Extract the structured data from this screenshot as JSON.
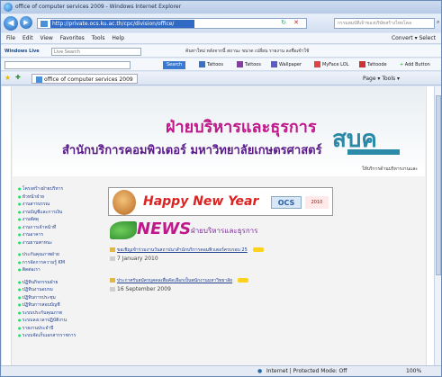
{
  "window": {
    "title": "office of computer services 2009 - Windows Internet Explorer"
  },
  "address": {
    "url": "http://private.ocs.ku.ac.th/cpc/division/office/",
    "search_placeholder": "กรรมสมบัติเจ้าของบริษัทสร้างไทยโคล"
  },
  "menu": {
    "items": [
      "File",
      "Edit",
      "View",
      "Favorites",
      "Tools",
      "Help"
    ],
    "right": "Convert ▾  Select"
  },
  "toolbar1": {
    "live": "Windows Live",
    "search_placeholder": "Live Search",
    "right": "ค้นหาใหม่  หลังจากนี้  สถานะ  ขนาด  เปลี่ยน  รายงาน    ลงชื่อเข้าใช้"
  },
  "toolbar2": {
    "search_btn": "Search",
    "links": [
      "Tattoos",
      "Tattoos",
      "Wallpaper",
      "MyFace LOL",
      "Tattoode",
      "Add Button"
    ]
  },
  "favbar": {
    "tab": "office of computer services 2009",
    "right": "Page ▾  Tools ▾"
  },
  "header": {
    "thai_title": "ฝ่ายบริหารและธุรการ",
    "thai_subtitle": "สำนักบริการคอมพิวเตอร์ มหาวิทยาลัยเกษตรศาสตร์",
    "logo": "สบค",
    "small": "ให้บริการด้านบริหารงานและ"
  },
  "leftnav": {
    "group1": [
      "โครงสร้างฝ่ายบริหาร",
      "หัวหน้าฝ่าย",
      "งานสารบรรณ",
      "งานบัญชีและการเงิน",
      "งานพัสดุ",
      "งานการเจ้าหน้าที่",
      "งานอาคาร",
      "งานยานพาหนะ"
    ],
    "group2": [
      "ประกันคุณภาพฝ่าย",
      "การจัดการความรู้ KM",
      "ติดต่อเรา"
    ],
    "group3": [
      "ปฏิทินกิจกรรมฝ่าย",
      "ปฏิทินงานอบรม",
      "ปฏิทินการประชุม",
      "ปฏิทินการสอบบัญชี",
      "ระบบประกันคุณภาพ",
      "ระบบลงเวลาปฏิบัติงาน",
      "รายงานประจำปี",
      "ระบบจัดเก็บเอกสารราชการ"
    ]
  },
  "banner": {
    "text": "Happy New Year",
    "ocs": "OCS",
    "year": "2010"
  },
  "news": {
    "title": "NEWS",
    "thai": "ฝ่ายบริหารและธุรการ",
    "items": [
      {
        "title": "ขอเชิญเข้าร่วมงานวันสถาปนาสำนักบริการคอมพิวเตอร์ครบรอบ 25",
        "date": "7 January 2010"
      },
      {
        "title": "ประกาศรับสมัครบุคคลเพื่อคัดเลือกเป็นพนักงานมหาวิทยาลัย",
        "date": "16 September 2009"
      }
    ]
  },
  "status": {
    "zone": "Internet | Protected Mode: Off",
    "zoom": "100%"
  }
}
